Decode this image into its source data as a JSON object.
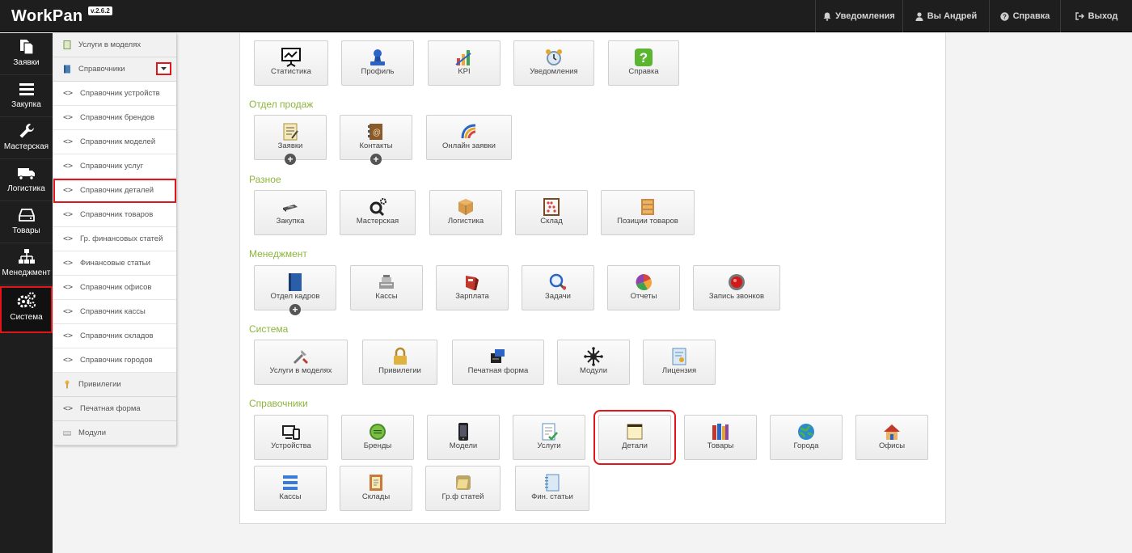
{
  "app": {
    "name": "WorkPan",
    "version": "v.2.6.2"
  },
  "topbar": {
    "notifications": "Уведомления",
    "user": "Вы Андрей",
    "help": "Справка",
    "logout": "Выход"
  },
  "leftnav": {
    "items": [
      {
        "label": "Заявки",
        "icon": "file-copy-icon"
      },
      {
        "label": "Закупка",
        "icon": "bars-icon"
      },
      {
        "label": "Мастерская",
        "icon": "wrench-icon"
      },
      {
        "label": "Логистика",
        "icon": "truck-icon"
      },
      {
        "label": "Товары",
        "icon": "hdd-icon"
      },
      {
        "label": "Менеджмент",
        "icon": "org-chart-icon"
      },
      {
        "label": "Система",
        "icon": "cogs-icon",
        "active": true
      }
    ]
  },
  "submenu": {
    "items": [
      "Услуги в моделях",
      "Справочники",
      "Справочник устройств",
      "Справочник брендов",
      "Справочник моделей",
      "Справочник услуг",
      "Справочник деталей",
      "Справочник товаров",
      "Гр. финансовых статей",
      "Финансовые статьи",
      "Справочник офисов",
      "Справочник кассы",
      "Справочник складов",
      "Справочник городов",
      "Привилегии",
      "Печатная форма",
      "Модули"
    ]
  },
  "sections": {
    "top": {
      "tiles": [
        "Статистика",
        "Профиль",
        "KPI",
        "Уведомления",
        "Справка"
      ]
    },
    "sales": {
      "title": "Отдел продаж",
      "tiles": [
        "Заявки",
        "Контакты",
        "Онлайн заявки"
      ]
    },
    "misc": {
      "title": "Разное",
      "tiles": [
        "Закупка",
        "Мастерская",
        "Логистика",
        "Склад",
        "Позиции товаров"
      ]
    },
    "management": {
      "title": "Менеджмент",
      "tiles": [
        "Отдел кадров",
        "Кассы",
        "Зарплата",
        "Задачи",
        "Отчеты",
        "Запись звонков"
      ]
    },
    "system": {
      "title": "Система",
      "tiles": [
        "Услуги в моделях",
        "Привилегии",
        "Печатная форма",
        "Модули",
        "Лицензия"
      ]
    },
    "refs": {
      "title": "Справочники",
      "tiles": [
        "Устройства",
        "Бренды",
        "Модели",
        "Услуги",
        "Детали",
        "Товары",
        "Города",
        "Офисы",
        "Кассы",
        "Склады",
        "Гр.ф статей",
        "Фин. статьи"
      ]
    }
  },
  "colors": {
    "accent": "#8db53c",
    "highlight": "#e0161b",
    "topbar": "#1e1e1e"
  }
}
